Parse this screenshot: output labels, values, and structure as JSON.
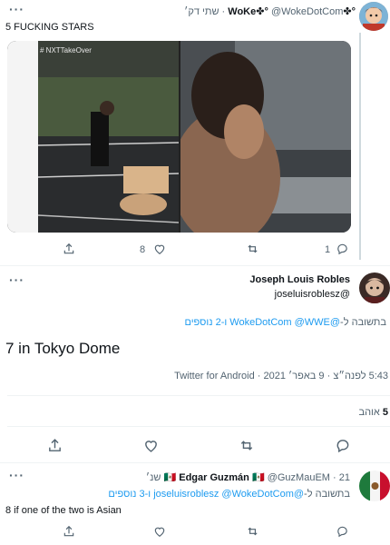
{
  "tweet1": {
    "display_name": "°✤WoKe✤°",
    "handle": "@WokeDotCom",
    "time": "שתי דק׳",
    "sep": "·",
    "text": "5 FUCKING STARS",
    "media_overlay": "# NXTTakeOver",
    "actions": {
      "replies": "",
      "retweets": "",
      "likes": "8",
      "likes_count_right": "1"
    }
  },
  "main_tweet": {
    "display_name": "Joseph Louis Robles",
    "handle": "@joseluisroblesz",
    "reply_prefix": "בתשובה ל-",
    "reply_handles": "@WokeDotCom @WWE",
    "reply_more": "ו-2 נוספים",
    "text": "7 in Tokyo Dome",
    "meta_time": "5:43 לפנה״צ · 9 באפר׳ 2021 · ",
    "meta_source": "Twitter for Android",
    "likes_num": "5",
    "likes_label": "אוהב"
  },
  "reply": {
    "display_name": "Edgar Guzmán",
    "flag": "🇲🇽",
    "handle": "@GuzMauEM",
    "time": "21 שנ׳",
    "sep": "·",
    "reply_prefix": "בתשובה ל-",
    "reply_handles": "@joseluisroblesz @WokeDotCom",
    "reply_more": "ו-3 נוספים",
    "text": "8 if one of the two is Asian"
  },
  "colors": {
    "accent": "#1d9bf0",
    "muted": "#536471",
    "divider": "#eff3f4"
  }
}
